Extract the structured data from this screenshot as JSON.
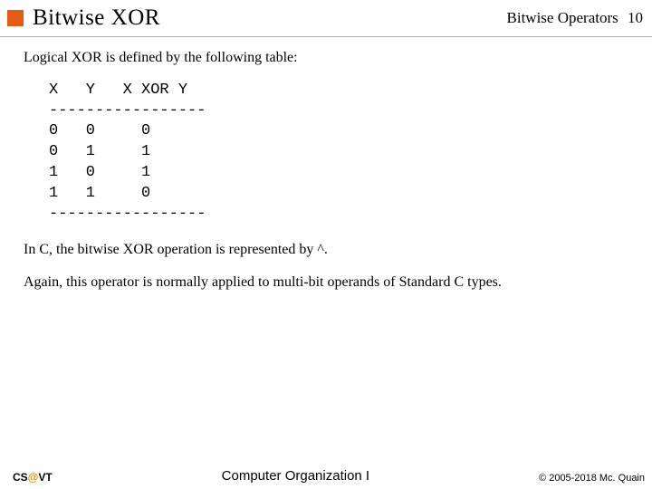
{
  "header": {
    "title": "Bitwise XOR",
    "section": "Bitwise Operators",
    "page": "10"
  },
  "body": {
    "intro": "Logical XOR is defined by the following table:",
    "table": "X   Y   X XOR Y\n-----------------\n0   0     0\n0   1     1\n1   0     1\n1   1     0\n-----------------",
    "line2": "In C, the bitwise XOR operation is represented by ^.",
    "line3": "Again, this operator is normally applied to multi-bit operands of Standard C types."
  },
  "footer": {
    "left_pre": "CS",
    "left_at": "@",
    "left_post": "VT",
    "center": "Computer Organization I",
    "right": "© 2005-2018 Mc. Quain"
  }
}
